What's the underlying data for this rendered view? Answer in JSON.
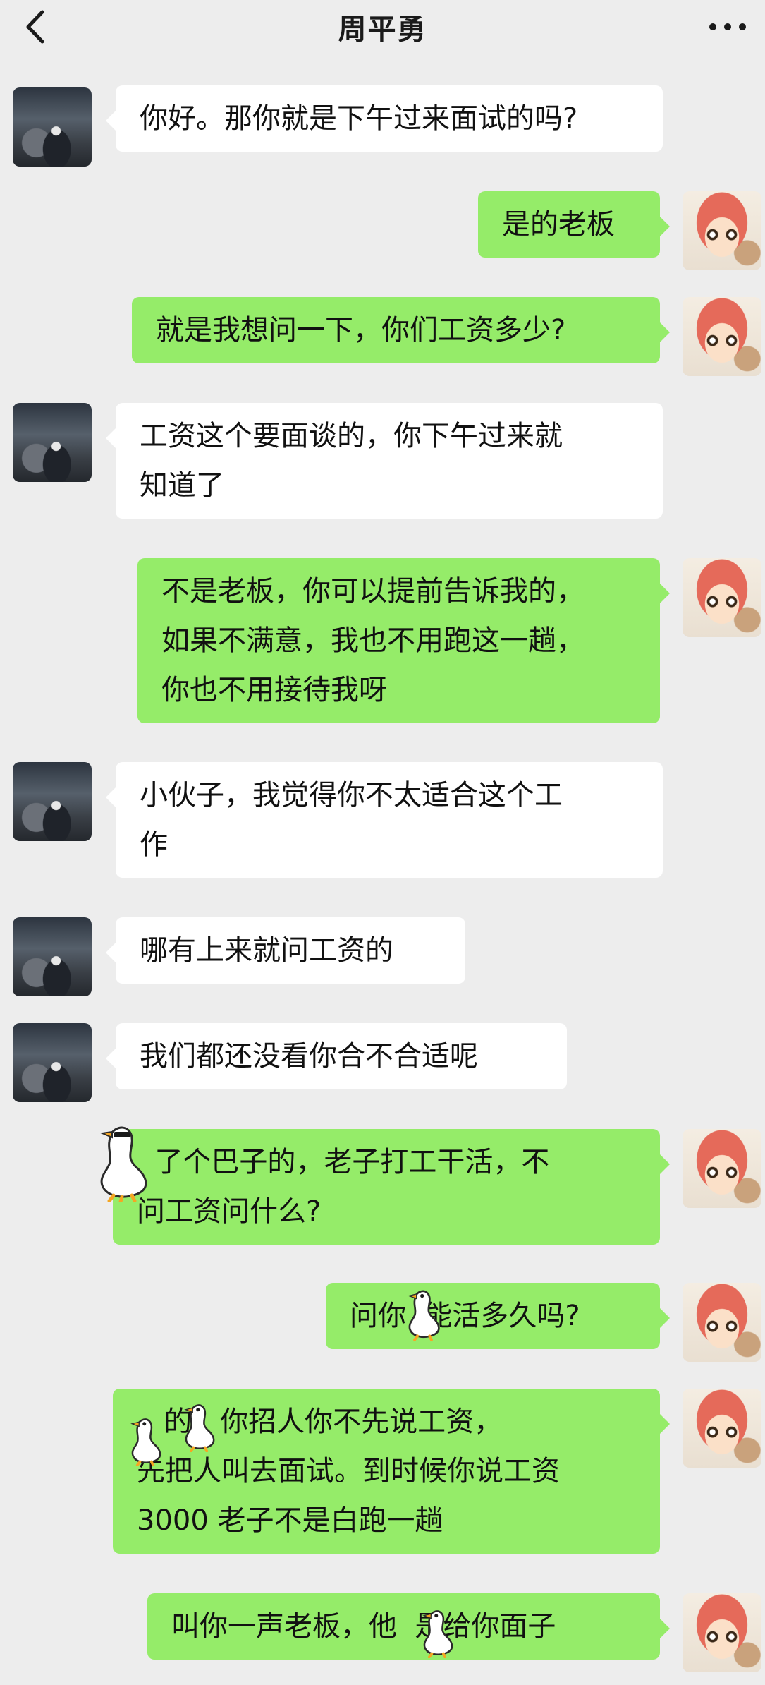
{
  "header": {
    "title": "周平勇",
    "back_icon": "chevron-left-icon",
    "more_icon": "more-dots-icon"
  },
  "colors": {
    "background": "#ededed",
    "incoming_bubble": "#ffffff",
    "outgoing_bubble": "#95ec69"
  },
  "messages": [
    {
      "sender": "other",
      "text": "你好。那你就是下午过来面试的吗?"
    },
    {
      "sender": "me",
      "text": "是的老板"
    },
    {
      "sender": "me",
      "text": "就是我想问一下，你们工资多少?"
    },
    {
      "sender": "other",
      "text": "工资这个要面谈的，你下午过来就\n知道了"
    },
    {
      "sender": "me",
      "text": "不是老板，你可以提前告诉我的，\n如果不满意，我也不用跑这一趟，\n你也不用接待我呀"
    },
    {
      "sender": "other",
      "text": "小伙子，我觉得你不太适合这个工\n作"
    },
    {
      "sender": "other",
      "text": "哪有上来就问工资的"
    },
    {
      "sender": "other",
      "text": "我们都还没看你合不合适呢"
    },
    {
      "sender": "me",
      "text": "  了个巴子的，老子打工干活，不\n问工资问什么?"
    },
    {
      "sender": "me",
      "text": "问你  能活多久吗?"
    },
    {
      "sender": "me",
      "text": "   的，你招人你不先说工资，\n先把人叫去面试。到时候你说工资\n3000 老子不是白跑一趟"
    },
    {
      "sender": "me",
      "text": "叫你一声老板，他  是给你面子"
    }
  ],
  "stickers": {
    "icon": "goose-sticker-icon"
  }
}
